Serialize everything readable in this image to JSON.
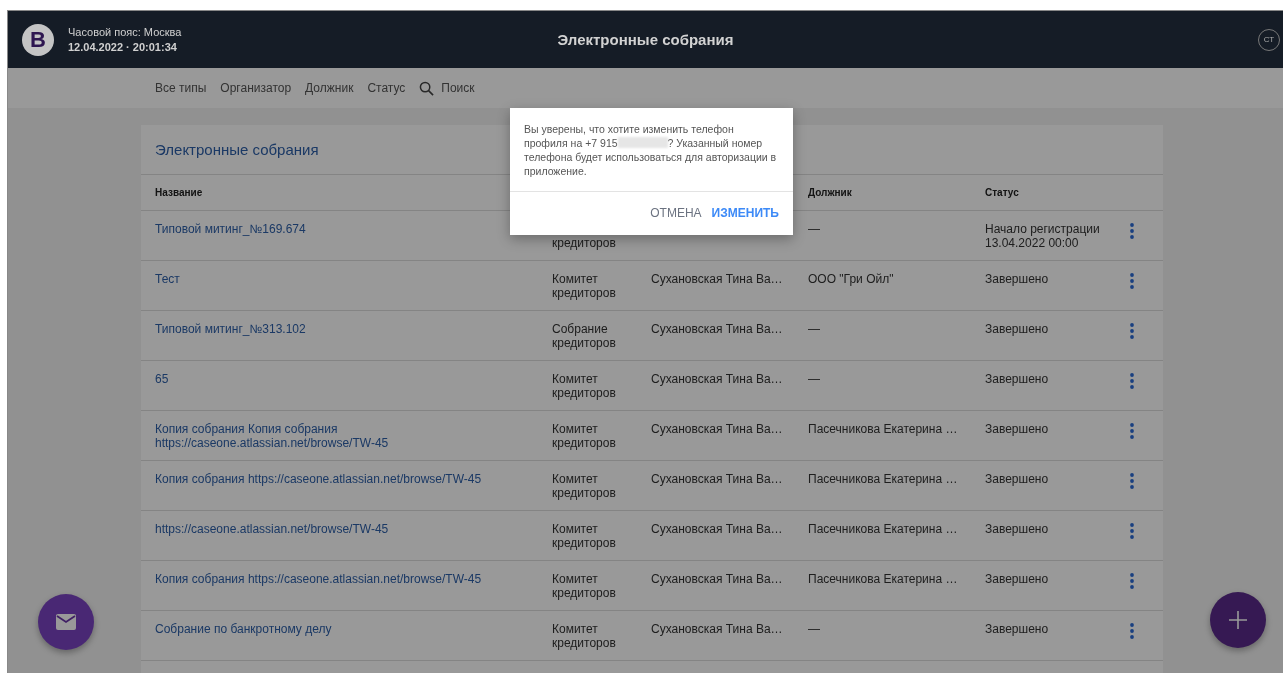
{
  "header": {
    "logo": "B",
    "timezone": "Часовой пояс: Москва",
    "datetime": "12.04.2022 · 20:01:34",
    "title": "Электронные собрания",
    "avatar": "СТ"
  },
  "filters": [
    {
      "label": "Все типы",
      "kind": "filter"
    },
    {
      "label": "Организатор",
      "kind": "filter"
    },
    {
      "label": "Должник",
      "kind": "filter"
    },
    {
      "label": "Статус",
      "kind": "filter"
    },
    {
      "label": "Поиск",
      "kind": "search"
    }
  ],
  "card": {
    "title": "Электронные собрания"
  },
  "table_header": {
    "name": "Название",
    "debtor": "Должник",
    "status": "Статус"
  },
  "rows": [
    {
      "name": "Типовой митинг_№169.674",
      "type": "кредиторов",
      "type_first_line_hidden": true,
      "debtor": "—",
      "status": "Начало регистрации 13.04.2022 00:00"
    },
    {
      "name": "Тест",
      "type": "Комитет кредиторов",
      "organizer": "Сухановская Тина Ва…",
      "debtor": "ООО \"Гри Ойл\"",
      "status": "Завершено"
    },
    {
      "name": "Типовой митинг_№313.102",
      "type": "Собрание кредиторов",
      "organizer": "Сухановская Тина Ва…",
      "debtor": "—",
      "status": "Завершено"
    },
    {
      "name": "65",
      "type": "Комитет кредиторов",
      "organizer": "Сухановская Тина Ва…",
      "debtor": "—",
      "status": "Завершено"
    },
    {
      "name": "Копия собрания Копия собрания https://caseone.atlassian.net/browse/TW-45",
      "type": "Комитет кредиторов",
      "organizer": "Сухановская Тина Ва…",
      "debtor": "Пасечникова Екатерина …",
      "status": "Завершено"
    },
    {
      "name": "Копия собрания https://caseone.atlassian.net/browse/TW-45",
      "type": "Комитет кредиторов",
      "organizer": "Сухановская Тина Ва…",
      "debtor": "Пасечникова Екатерина …",
      "status": "Завершено"
    },
    {
      "name": "https://caseone.atlassian.net/browse/TW-45",
      "type": "Комитет кредиторов",
      "organizer": "Сухановская Тина Ва…",
      "debtor": "Пасечникова Екатерина …",
      "status": "Завершено"
    },
    {
      "name": "Копия собрания https://caseone.atlassian.net/browse/TW-45",
      "type": "Комитет кредиторов",
      "organizer": "Сухановская Тина Ва…",
      "debtor": "Пасечникова Екатерина …",
      "status": "Завершено"
    },
    {
      "name": "Собрание по банкротному делу",
      "type": "Комитет кредиторов",
      "organizer": "Сухановская Тина Ва…",
      "debtor": "—",
      "status": "Завершено"
    }
  ],
  "dialog": {
    "message_before": "Вы уверены, что хотите изменить телефон профиля на +7 915",
    "phone_redacted": true,
    "message_after": "? Указанный номер телефона будет использоваться для авторизации в приложение.",
    "buttons": [
      {
        "label": "ОТМЕНА",
        "kind": "secondary"
      },
      {
        "label": "ИЗМЕНИТЬ",
        "kind": "primary"
      }
    ]
  },
  "fabs": [
    {
      "kind": "mail"
    },
    {
      "kind": "add"
    }
  ]
}
